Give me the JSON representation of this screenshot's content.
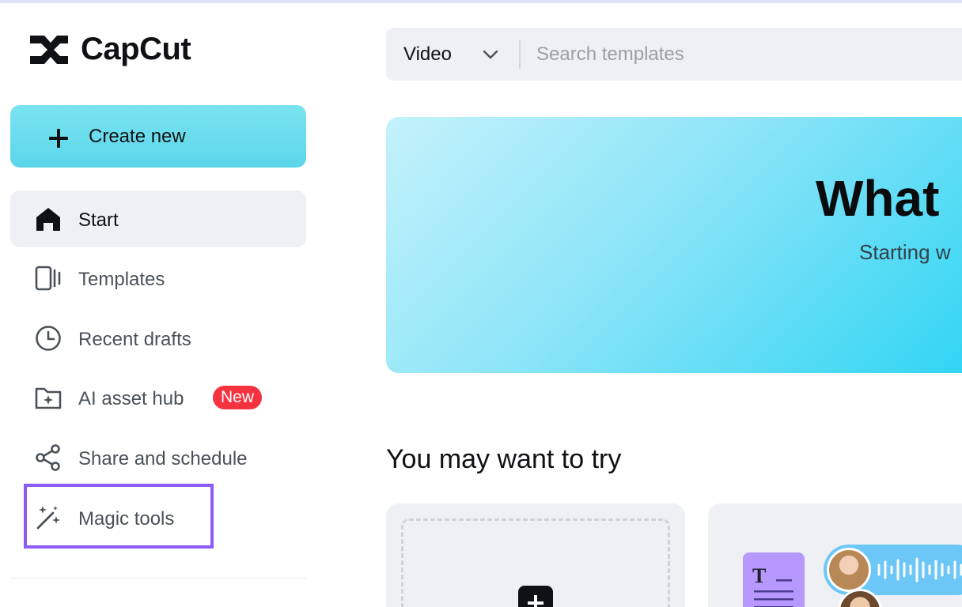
{
  "app": {
    "name": "CapCut"
  },
  "sidebar": {
    "create_label": "Create new",
    "items": [
      {
        "label": "Start",
        "icon": "home-icon",
        "active": true
      },
      {
        "label": "Templates",
        "icon": "templates-icon"
      },
      {
        "label": "Recent drafts",
        "icon": "clock-icon"
      },
      {
        "label": "AI asset hub",
        "icon": "asset-folder-icon",
        "badge": "New"
      },
      {
        "label": "Share and schedule",
        "icon": "share-icon"
      },
      {
        "label": "Magic tools",
        "icon": "magic-wand-icon",
        "highlighted": true
      }
    ]
  },
  "search": {
    "type_value": "Video",
    "placeholder": "Search templates"
  },
  "hero": {
    "title": "What",
    "subtitle": "Starting w"
  },
  "section": {
    "title": "You may want to try"
  },
  "colors": {
    "accent": "#5cd6ea",
    "badge": "#f5333f",
    "highlight": "#8b5cf6"
  }
}
